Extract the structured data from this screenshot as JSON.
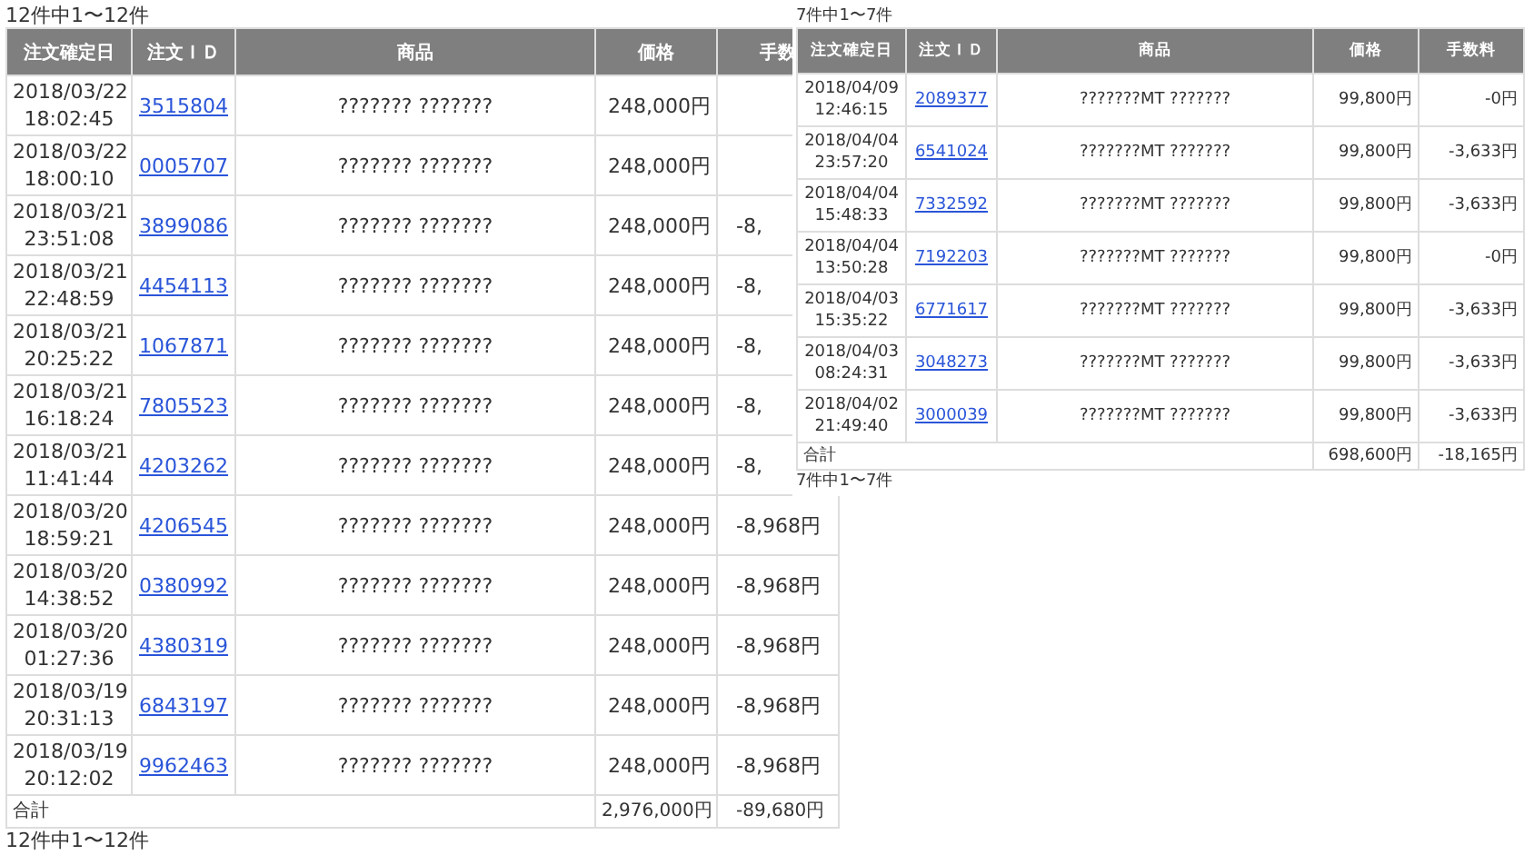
{
  "left_table": {
    "count_top": "12件中1〜12件",
    "columns": [
      "注文確定日",
      "注文ＩＤ",
      "商品",
      "価格",
      "手数"
    ],
    "rows": [
      {
        "date": "2018/03/22",
        "time": "18:02:45",
        "order_id": "3515804",
        "product": "??????? ???????",
        "price": "248,000円"
      },
      {
        "date": "2018/03/22",
        "time": "18:00:10",
        "order_id": "0005707",
        "product": "??????? ???????",
        "price": "248,000円"
      },
      {
        "date": "2018/03/21",
        "time": "23:51:08",
        "order_id": "3899086",
        "product": "??????? ???????",
        "price": "248,000円",
        "fee": "-8,"
      },
      {
        "date": "2018/03/21",
        "time": "22:48:59",
        "order_id": "4454113",
        "product": "??????? ???????",
        "price": "248,000円",
        "fee": "-8,"
      },
      {
        "date": "2018/03/21",
        "time": "20:25:22",
        "order_id": "1067871",
        "product": "??????? ???????",
        "price": "248,000円",
        "fee": "-8,"
      },
      {
        "date": "2018/03/21",
        "time": "16:18:24",
        "order_id": "7805523",
        "product": "??????? ???????",
        "price": "248,000円",
        "fee": "-8,"
      },
      {
        "date": "2018/03/21",
        "time": "11:41:44",
        "order_id": "4203262",
        "product": "??????? ???????",
        "price": "248,000円",
        "fee": "-8,"
      },
      {
        "date": "2018/03/20",
        "time": "18:59:21",
        "order_id": "4206545",
        "product": "??????? ???????",
        "price": "248,000円",
        "fee": "-8,968円"
      },
      {
        "date": "2018/03/20",
        "time": "14:38:52",
        "order_id": "0380992",
        "product": "??????? ???????",
        "price": "248,000円",
        "fee": "-8,968円"
      },
      {
        "date": "2018/03/20",
        "time": "01:27:36",
        "order_id": "4380319",
        "product": "??????? ???????",
        "price": "248,000円",
        "fee": "-8,968円"
      },
      {
        "date": "2018/03/19",
        "time": "20:31:13",
        "order_id": "6843197",
        "product": "??????? ???????",
        "price": "248,000円",
        "fee": "-8,968円"
      },
      {
        "date": "2018/03/19",
        "time": "20:12:02",
        "order_id": "9962463",
        "product": "??????? ???????",
        "price": "248,000円",
        "fee": "-8,968円"
      }
    ],
    "total": {
      "label": "合計",
      "price": "2,976,000円",
      "fee": "-89,680円"
    },
    "count_bottom": "12件中1〜12件"
  },
  "right_table": {
    "count_top": "7件中1〜7件",
    "columns": [
      "注文確定日",
      "注文ＩＤ",
      "商品",
      "価格",
      "手数料"
    ],
    "rows": [
      {
        "date": "2018/04/09",
        "time": "12:46:15",
        "order_id": "2089377",
        "product": "???????MT ???????",
        "price": "99,800円",
        "fee": "-0円"
      },
      {
        "date": "2018/04/04",
        "time": "23:57:20",
        "order_id": "6541024",
        "product": "???????MT ???????",
        "price": "99,800円",
        "fee": "-3,633円"
      },
      {
        "date": "2018/04/04",
        "time": "15:48:33",
        "order_id": "7332592",
        "product": "???????MT ???????",
        "price": "99,800円",
        "fee": "-3,633円"
      },
      {
        "date": "2018/04/04",
        "time": "13:50:28",
        "order_id": "7192203",
        "product": "???????MT ???????",
        "price": "99,800円",
        "fee": "-0円"
      },
      {
        "date": "2018/04/03",
        "time": "15:35:22",
        "order_id": "6771617",
        "product": "???????MT ???????",
        "price": "99,800円",
        "fee": "-3,633円"
      },
      {
        "date": "2018/04/03",
        "time": "08:24:31",
        "order_id": "3048273",
        "product": "???????MT ???????",
        "price": "99,800円",
        "fee": "-3,633円"
      },
      {
        "date": "2018/04/02",
        "time": "21:49:40",
        "order_id": "3000039",
        "product": "???????MT ???????",
        "price": "99,800円",
        "fee": "-3,633円"
      }
    ],
    "total": {
      "label": "合計",
      "price": "698,600円",
      "fee": "-18,165円"
    },
    "count_bottom": "7件中1〜7件"
  }
}
